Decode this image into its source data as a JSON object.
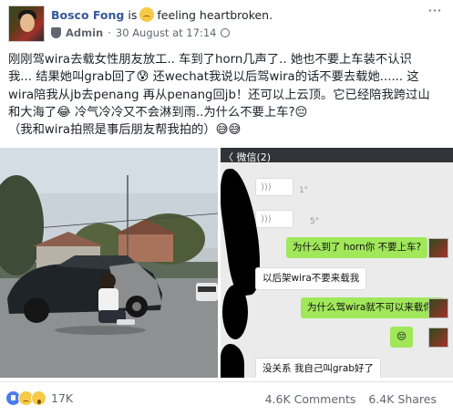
{
  "post": {
    "author": "Bosco Fong",
    "is_word": "is",
    "feeling": "feeling heartbroken.",
    "feeling_icon": "heartbroken-emoji-icon",
    "role": "Admin",
    "separator": "·",
    "date": "30 August at 17:14",
    "privacy_icon": "globe-icon",
    "more_label": "···",
    "text_lines": [
      "刚刚驾wira去载女性朋友放工.. 车到了horn几声了.. 她也不要上车装不认识",
      "我... 结果她叫grab回了😰 还wechat我说以后驾wira的话不要去载她...... 这",
      "wira陪我从jb去penang 再从penang回jb！还可以上云顶。它已经陪我跨过山",
      "和大海了😂 冷气冷冷又不会淋到雨..为什么不要上车?😔",
      "（我和wira拍照是事后朋友帮我拍的）😅😅"
    ]
  },
  "chat": {
    "back_label": "〈 微信(2)",
    "voice_lengths": [
      "1\"",
      "5\""
    ],
    "messages": [
      {
        "from": "me",
        "text": "为什么到了 horn你 不要上车?"
      },
      {
        "from": "them",
        "text": "以后架wira不要来载我"
      },
      {
        "from": "me",
        "text": "为什么驾wira就不可以来载你?"
      },
      {
        "from": "me",
        "text": "😔"
      },
      {
        "from": "them",
        "text": "没关系 我自己叫grab好了"
      }
    ]
  },
  "footer": {
    "reaction_icons": [
      "like-icon",
      "sad-icon",
      "wow-icon"
    ],
    "reaction_count": "17K",
    "comments": "4.6K Comments",
    "shares": "6.4K Shares"
  },
  "colors": {
    "author_link": "#365899",
    "meta_text": "#606770",
    "my_bubble": "#a0e75a",
    "chat_bar": "#303438"
  }
}
